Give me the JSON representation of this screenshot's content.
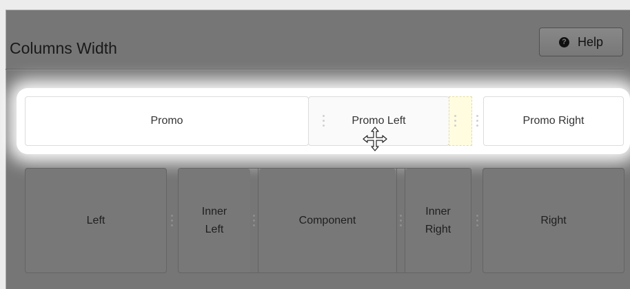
{
  "header": {
    "title": "Columns Width",
    "help_label": "Help",
    "help_icon": "?"
  },
  "top_row": {
    "columns": [
      {
        "label": "Promo"
      },
      {
        "label": "Promo Left"
      },
      {
        "label": "Promo Right"
      }
    ]
  },
  "bottom_row": {
    "columns": [
      {
        "label": "Left"
      },
      {
        "label_line1": "Inner",
        "label_line2": "Left"
      },
      {
        "label": "Component"
      },
      {
        "label_line1": "Inner",
        "label_line2": "Right"
      },
      {
        "label": "Right"
      }
    ]
  },
  "colors": {
    "overlay": "#767676",
    "drop_placeholder": "#fffce0"
  }
}
